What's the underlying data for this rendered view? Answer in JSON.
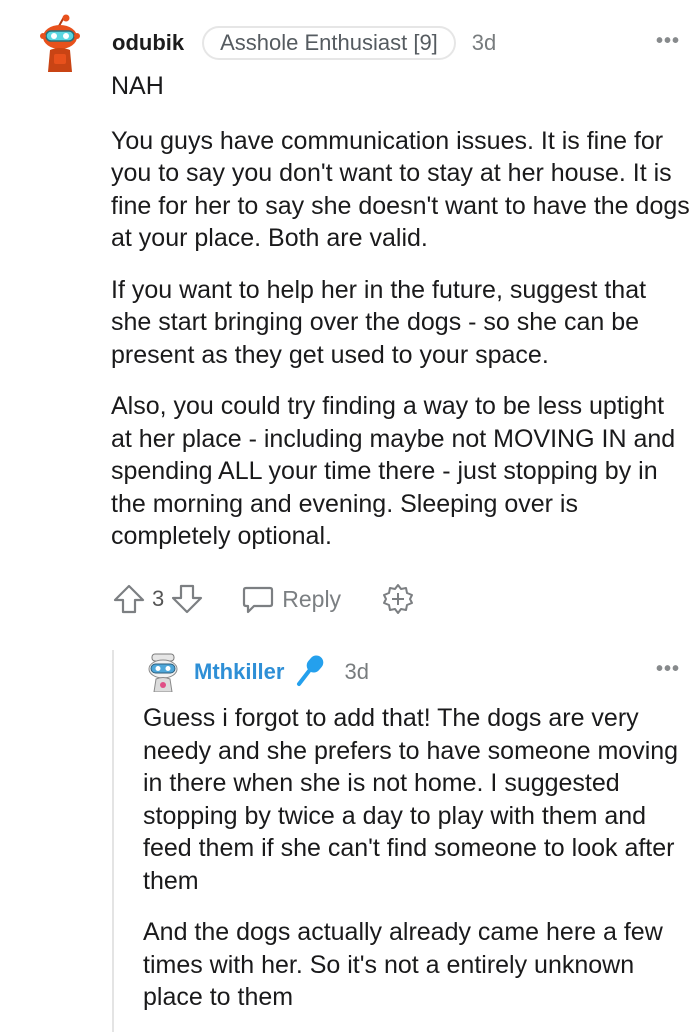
{
  "comment": {
    "username": "odubik",
    "flair": "Asshole Enthusiast [9]",
    "time": "3d",
    "more": "•••",
    "paragraphs": [
      "NAH",
      "You guys have communication issues. It is fine for you to say you don't want to stay at her house. It is fine for her to say she doesn't want to have the dogs at your place. Both are valid.",
      "If you want to help her in the future, suggest that she start bringing over the dogs - so she can be present as they get used to your space.",
      "Also, you could try finding a way to be less uptight at her place - including maybe not MOVING IN and spending ALL your time there - just stopping by in the morning and evening. Sleeping over is completely optional."
    ],
    "actions": {
      "upvote_icon": "arrow-up-icon",
      "vote_count": "3",
      "downvote_icon": "arrow-down-icon",
      "reply_label": "Reply",
      "award_icon": "award-plus-icon"
    }
  },
  "reply": {
    "username": "Mthkiller",
    "badge_icon": "microphone-icon",
    "time": "3d",
    "more": "•••",
    "paragraphs": [
      "Guess i forgot to add that! The dogs are very needy and she prefers to have someone moving in there when she is not home. I suggested stopping by twice a day to play with them and feed them if she can't find someone to look after them",
      "And the dogs actually already came here a few times with her. So it's not a entirely unknown place to them"
    ]
  },
  "colors": {
    "username_reply": "#2e8fd6",
    "mic_badge": "#24a0ed",
    "avatar_top_orange": "#e8511c",
    "avatar_top_cyan": "#5ad6e0"
  }
}
